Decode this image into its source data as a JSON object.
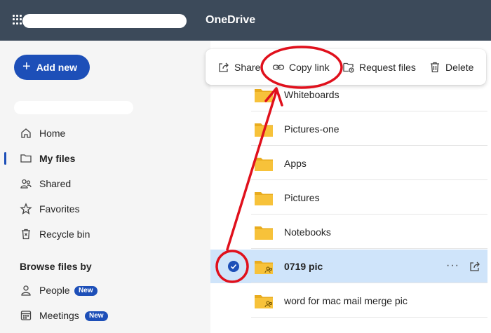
{
  "header": {
    "app_title": "OneDrive"
  },
  "sidebar": {
    "add_new_label": "Add new",
    "nav": [
      {
        "label": "Home",
        "icon": "home-icon"
      },
      {
        "label": "My files",
        "icon": "folder-icon"
      },
      {
        "label": "Shared",
        "icon": "people-icon"
      },
      {
        "label": "Favorites",
        "icon": "star-icon"
      },
      {
        "label": "Recycle bin",
        "icon": "trash-icon"
      }
    ],
    "browse_heading": "Browse files by",
    "browse": [
      {
        "label": "People",
        "badge": "New",
        "icon": "person-icon"
      },
      {
        "label": "Meetings",
        "badge": "New",
        "icon": "calendar-icon"
      }
    ]
  },
  "toolbar": {
    "share": "Share",
    "copy_link": "Copy link",
    "request_files": "Request files",
    "delete": "Delete"
  },
  "files": [
    {
      "name": "Whiteboards",
      "shared": false
    },
    {
      "name": "Pictures-one",
      "shared": false
    },
    {
      "name": "Apps",
      "shared": false
    },
    {
      "name": "Pictures",
      "shared": false
    },
    {
      "name": "Notebooks",
      "shared": false
    },
    {
      "name": "0719 pic",
      "shared": true,
      "selected": true
    },
    {
      "name": "word for mac mail merge pic",
      "shared": true
    }
  ],
  "colors": {
    "header_bg": "#3c4a5a",
    "accent": "#1d4fb8",
    "selected_row": "#cfe4fa",
    "annotation": "#e0101c",
    "folder": "#f7c23a"
  }
}
